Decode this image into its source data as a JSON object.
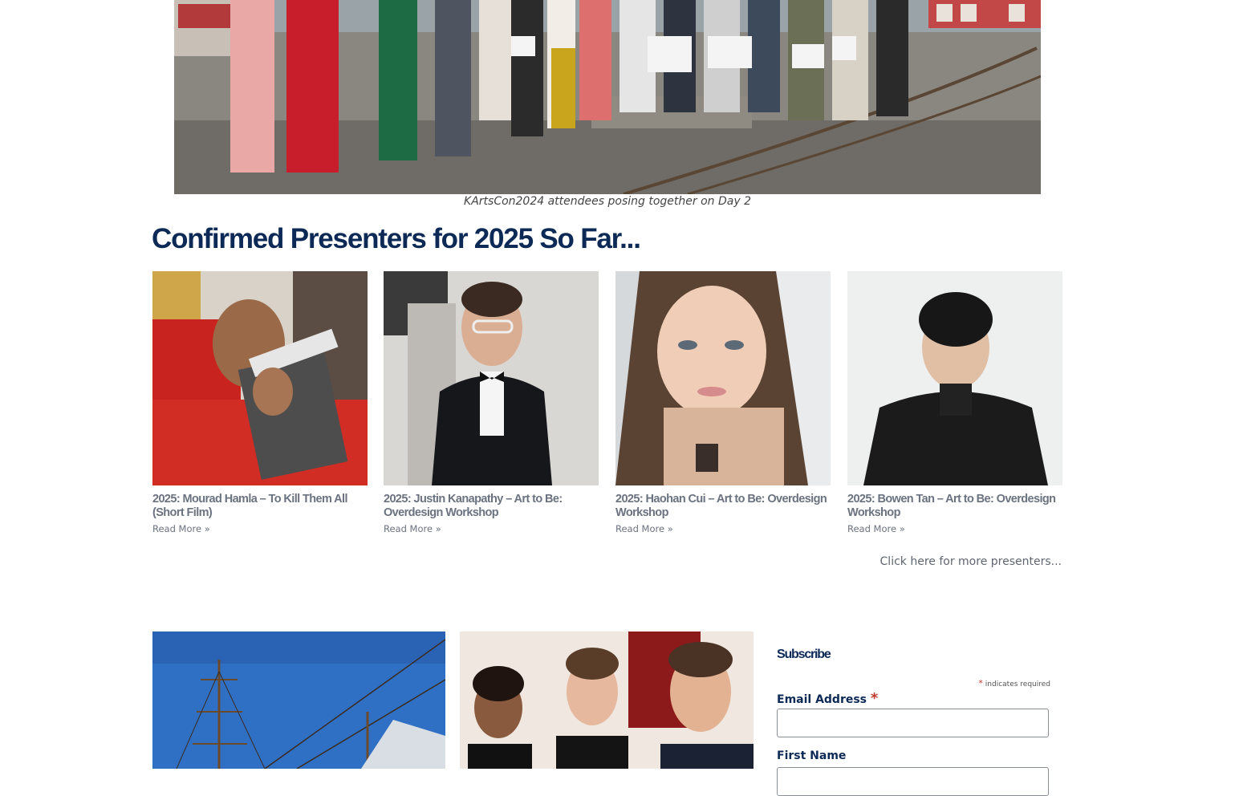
{
  "hero": {
    "caption": "KArtsCon2024 attendees posing together on Day 2"
  },
  "presenters": {
    "heading": "Confirmed Presenters for 2025 So Far...",
    "items": [
      {
        "title": "2025: Mourad Hamla – To Kill Them All (Short Film)",
        "more": "Read More »"
      },
      {
        "title": "2025: Justin Kanapathy – Art to Be: Overdesign Workshop",
        "more": "Read More »"
      },
      {
        "title": "2025: Haohan Cui – Art to Be: Overdesign Workshop",
        "more": "Read More »"
      },
      {
        "title": "2025: Bowen Tan – Art to Be: Overdesign Workshop",
        "more": "Read More »"
      }
    ],
    "more_link": "Click here for more presenters..."
  },
  "subscribe": {
    "title": "Subscribe",
    "required_note": "indicates required",
    "required_star": "*",
    "email_label": "Email Address",
    "first_name_label": "First Name"
  },
  "colors": {
    "heading": "#0d2a57",
    "meta_text": "#6b7280",
    "required": "#c0392b"
  }
}
